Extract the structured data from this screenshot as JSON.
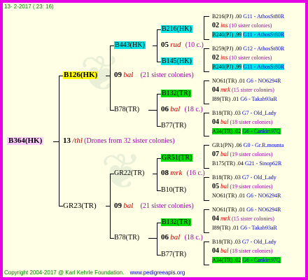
{
  "header": {
    "date": "13- 2-2017 ( 23: 16)"
  },
  "footer": {
    "copyright": "Copyright 2004-2017 @ Karl Kehrle Foundation.",
    "url": "www.pedigreeapis.org"
  },
  "colors": {
    "border": "#e600e6",
    "background": "#ffffe6",
    "highlight_root": "#ffccff",
    "highlight_sire": "#ffff00",
    "highlight_cyan": "#00e5e5",
    "highlight_green": "#00dd00"
  },
  "root": {
    "label": "B364(HK)"
  },
  "gen1_note": {
    "num": "13",
    "mark": "/thl",
    "text": "(Drones from 32 sister colonies)"
  },
  "sire": {
    "label": "B126(HK)",
    "num": "09",
    "mark": "bal",
    "note": "(21 sister colonies)",
    "a": {
      "label": "B443(HK)",
      "num": "05",
      "mark": "rud",
      "note": "(10 c.)",
      "a": {
        "label": "B216(HK)"
      },
      "b": {
        "label": "B145(HK)"
      }
    },
    "b": {
      "label": "B78(TR)",
      "num": "06",
      "mark": "bal",
      "note": "(18 c.)",
      "a": {
        "label": "B132(TR)"
      },
      "b": {
        "label": "B77(TR)"
      }
    }
  },
  "dam": {
    "label": "GR23(TR)",
    "num": "09",
    "mark": "bal",
    "note": "(21 sister colonies)",
    "a": {
      "label": "GR22(TR)",
      "num": "08",
      "mark": "mrk",
      "note": "(16 c.)",
      "a": {
        "label": "GR51(TR)"
      },
      "b": {
        "label": "B10(TR)"
      }
    },
    "b": {
      "label": "B78(TR)",
      "num": "06",
      "mark": "bal",
      "note": "(18 c.)",
      "a": {
        "label": "B132(TR)"
      },
      "b": {
        "label": "B77(TR)"
      }
    }
  },
  "gen4": [
    {
      "top": {
        "id": "B216(PJ)",
        "val": ".00",
        "line": "G11 - AthosSt80R"
      },
      "mid": {
        "num": "02",
        "mark": "ins",
        "note": "(10 sister colonies)"
      },
      "bot": {
        "id": "B240(PJ)",
        "val": ".99",
        "line": "G11 - AthosSt80R"
      }
    },
    {
      "top": {
        "id": "B259(PJ)",
        "val": ".00",
        "line": "G12 - AthosSt80R"
      },
      "mid": {
        "num": "02",
        "mark": "ins",
        "note": "(10 sister colonies)"
      },
      "bot": {
        "id": "B240(PJ)",
        "val": ".99",
        "line": "G11 - AthosSt80R"
      }
    },
    {
      "top": {
        "id": "NO61(TR)",
        "val": ".01",
        "line": "G6 - NO6294R"
      },
      "mid": {
        "num": "04",
        "mark": "mrk",
        "note": "(15 sister colonies)"
      },
      "bot": {
        "id": "I89(TR)",
        "val": ".01",
        "line": "G6 - Takab93aR"
      }
    },
    {
      "top": {
        "id": "B18(TR)",
        "val": ".03",
        "line": "G7 - Old_Lady"
      },
      "mid": {
        "num": "04",
        "mark": "bal",
        "note": "(18 sister colonies)"
      },
      "bot": {
        "id": "A34(TR)",
        "val": ".02",
        "line": "G6 - Cankiri97Q"
      }
    },
    {
      "top": {
        "id": "GR1(PN)",
        "val": ".06",
        "line": "G0 - Gr.R.mounta"
      },
      "mid": {
        "num": "07",
        "mark": "bal",
        "note": "(19 sister colonies)"
      },
      "bot": {
        "id": "B175(TR)",
        "val": ".04",
        "line": "G21 - Sinop62R"
      }
    },
    {
      "top": {
        "id": "B18(TR)",
        "val": ".03",
        "line": "G7 - Old_Lady"
      },
      "mid": {
        "num": "05",
        "mark": "bal",
        "note": "(19 sister colonies)"
      },
      "bot": {
        "id": "NO61(TR)",
        "val": ".01",
        "line": "G6 - NO6294R"
      }
    },
    {
      "top": {
        "id": "NO61(TR)",
        "val": ".01",
        "line": "G6 - NO6294R"
      },
      "mid": {
        "num": "04",
        "mark": "mrk",
        "note": "(15 sister colonies)"
      },
      "bot": {
        "id": "I89(TR)",
        "val": ".01",
        "line": "G6 - Takab93aR"
      }
    },
    {
      "top": {
        "id": "B18(TR)",
        "val": ".03",
        "line": "G7 - Old_Lady"
      },
      "mid": {
        "num": "04",
        "mark": "bal",
        "note": "(18 sister colonies)"
      },
      "bot": {
        "id": "A34(TR)",
        "val": ".02",
        "line": "G6 - Cankiri97Q"
      }
    }
  ]
}
